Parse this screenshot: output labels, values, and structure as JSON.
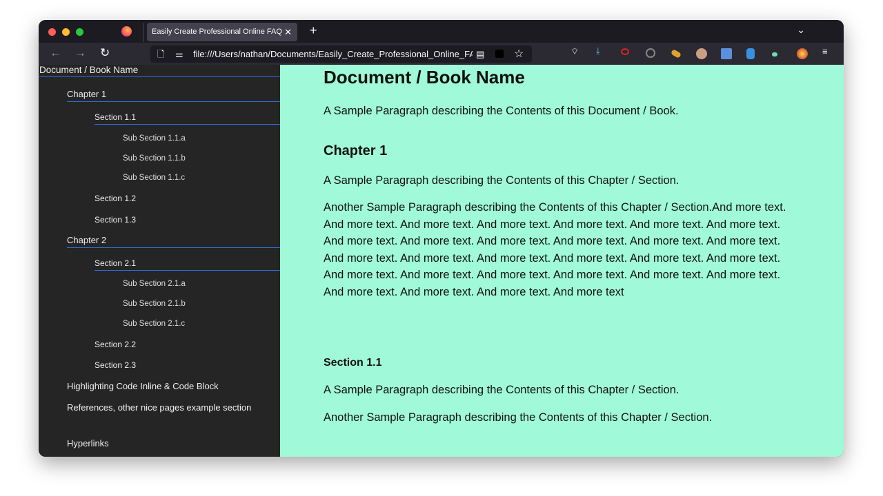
{
  "browser": {
    "tab_title": "Easily Create Professional Online FAQ",
    "new_tab": "+",
    "url": "file:///Users/nathan/Documents/Easily_Create_Professional_Online_FAQ",
    "traffic_colors": [
      "#ff5f57",
      "#febc2e",
      "#28c840"
    ],
    "toolbar_icons": [
      "back-icon",
      "forward-icon",
      "reload-icon",
      "page-icon",
      "permissions-icon",
      "reader-view-icon",
      "extension-icon",
      "bookmark-star-icon"
    ],
    "extension_icons": [
      "pocket-icon",
      "downloads-icon",
      "link-icon",
      "download-circle-icon",
      "pencil-icon",
      "face-icon",
      "save-icon",
      "file-download-icon",
      "eyedropper-icon",
      "color-icon",
      "menu-icon"
    ]
  },
  "sidebar": {
    "title": "Document / Book Name",
    "items": [
      {
        "label": "Chapter 1"
      },
      {
        "label": "Section 1.1"
      },
      {
        "label": "Sub Section 1.1.a"
      },
      {
        "label": "Sub Section 1.1.b"
      },
      {
        "label": "Sub Section 1.1.c"
      },
      {
        "label": "Section 1.2"
      },
      {
        "label": "Section 1.3"
      },
      {
        "label": "Chapter 2"
      },
      {
        "label": "Section 2.1"
      },
      {
        "label": "Sub Section 2.1.a"
      },
      {
        "label": "Sub Section 2.1.b"
      },
      {
        "label": "Sub Section 2.1.c"
      },
      {
        "label": "Section 2.2"
      },
      {
        "label": "Section 2.3"
      },
      {
        "label": "Highlighting Code Inline & Code Block"
      },
      {
        "label": "References, other nice pages example section"
      },
      {
        "label": "Hyperlinks"
      }
    ]
  },
  "main": {
    "title": "Document / Book Name",
    "intro": "A Sample Paragraph describing the Contents of this Document / Book.",
    "chapter_title": "Chapter 1",
    "chapter_p1": "A Sample Paragraph describing the Contents of this Chapter / Section.",
    "chapter_p2": "Another Sample Paragraph describing the Contents of this Chapter / Section.And more text. And more text. And more text. And more text. And more text. And more text. And more text. And more text. And more text. And more text. And more text. And more text. And more text. And more text. And more text. And more text. And more text. And more text. And more text. And more text. And more text. And more text. And more text. And more text. And more text. And more text. And more text. And more text. And more text",
    "section_title": "Section 1.1",
    "section_p1": "A Sample Paragraph describing the Contents of this Chapter / Section.",
    "section_p2": "Another Sample Paragraph describing the Contents of this Chapter / Section."
  },
  "colors": {
    "sidebar_bg": "#252525",
    "main_bg": "#a0f9d8",
    "accent": "#2d6fd6"
  }
}
